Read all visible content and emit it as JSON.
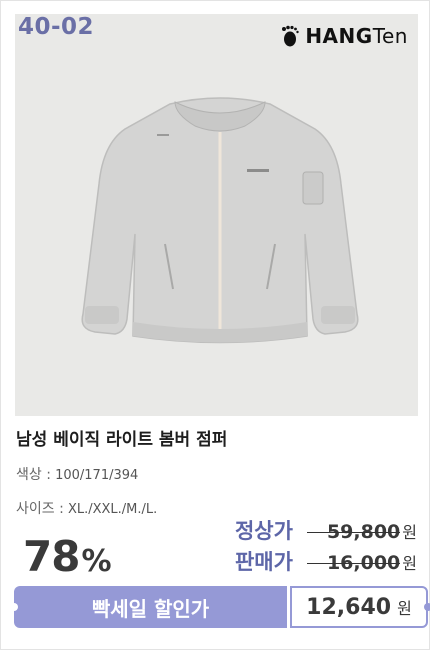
{
  "product": {
    "code": "40-02",
    "brand": "HANGTEN",
    "brand_main": "HANG",
    "brand_tail": "Ten",
    "title": "남성 베이직 라이트 봄버 점퍼",
    "color_key": "색상 :",
    "color_value": "100/171/394",
    "size_key": "사이즈 :",
    "size_value": "XL./XXL./M./L."
  },
  "pricing": {
    "discount_number": "78",
    "discount_symbol": "%",
    "regular_label": "정상가",
    "regular_price": "59,800",
    "sale_label": "판매가",
    "sale_price": "16,000",
    "currency": "원"
  },
  "deal": {
    "label": "빡세일 할인가",
    "price": "12,640",
    "currency": "원"
  },
  "colors": {
    "accent": "#9599d6",
    "code_color": "#6a6fa6",
    "label_color": "#5d66a8",
    "image_bg": "#e9e9e7"
  }
}
